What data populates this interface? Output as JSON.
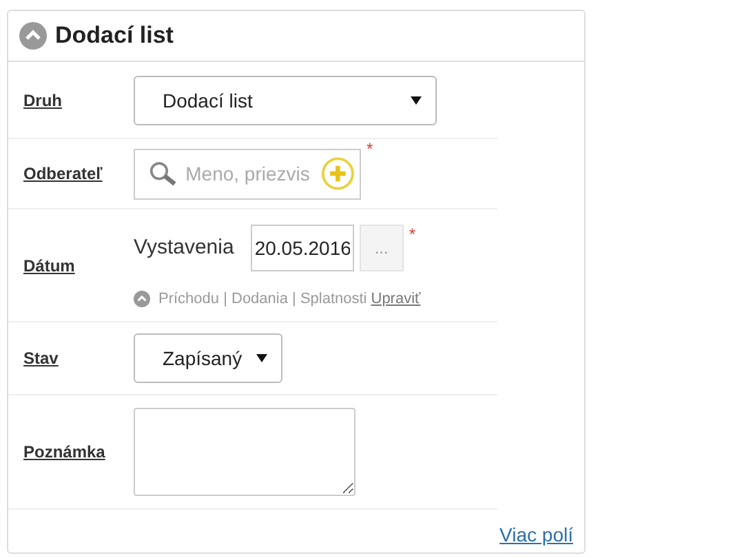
{
  "panel": {
    "title": "Dodací list",
    "expanded": true
  },
  "rows": [
    {
      "kind": "select",
      "label": "Druh",
      "value": "Dodací list"
    },
    {
      "kind": "search",
      "label": "Odberateľ",
      "placeholder": "Meno, priezvis",
      "required_mark": "*"
    },
    {
      "kind": "date",
      "label": "Dátum",
      "caption": "Vystavenia",
      "value": "20.05.2016",
      "button": "...",
      "required_mark": "*",
      "more": "Príchodu | Dodania | Splatnosti",
      "more_link": "Upraviť"
    },
    {
      "kind": "compactselect",
      "label": "Stav",
      "value": "Zapísaný"
    },
    {
      "kind": "textarea",
      "label": "Poznámka"
    }
  ],
  "footer_link": "Viac polí"
}
